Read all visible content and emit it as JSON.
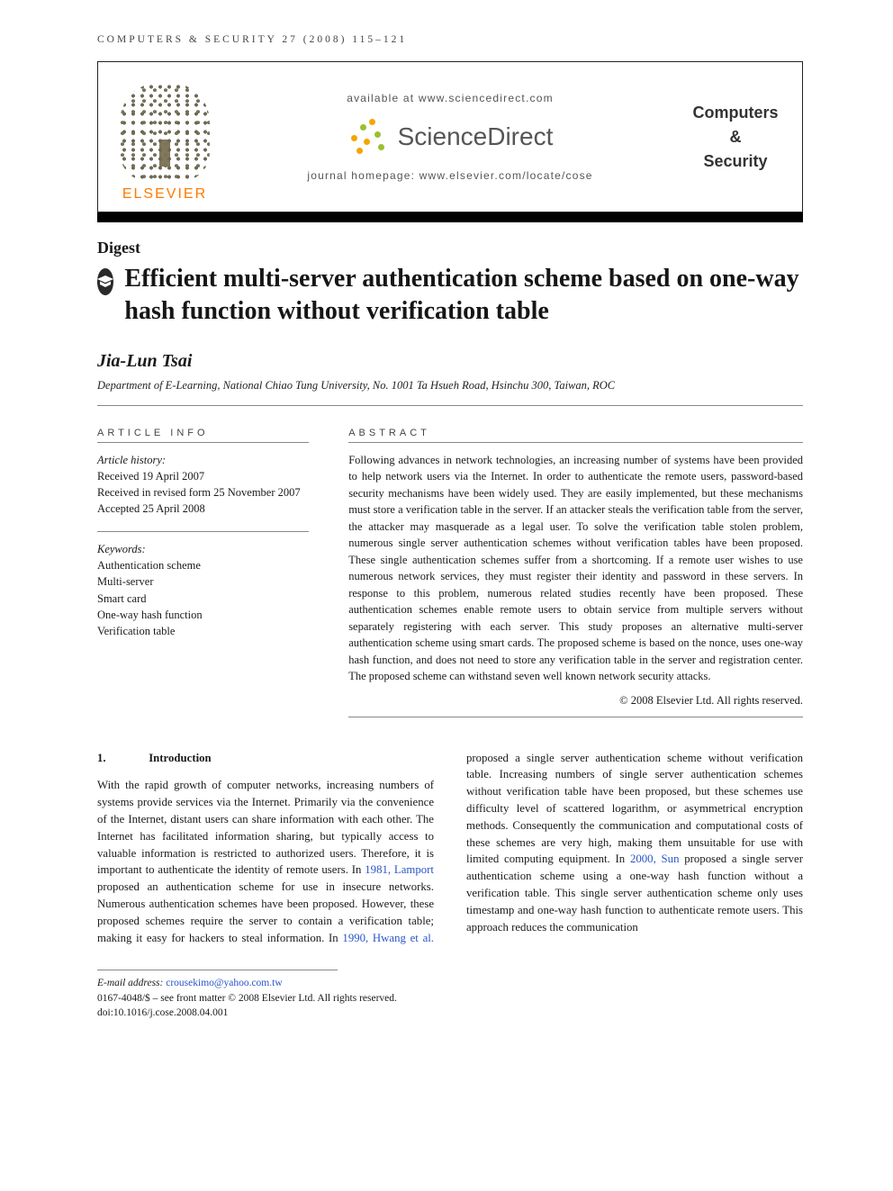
{
  "running_head": "COMPUTERS & SECURITY 27 (2008) 115–121",
  "banner": {
    "available_at": "available at www.sciencedirect.com",
    "sd_brand": "ScienceDirect",
    "homepage": "journal homepage: www.elsevier.com/locate/cose",
    "elsevier": "ELSEVIER",
    "journal_lines": [
      "Computers",
      "&",
      "Security"
    ]
  },
  "section_label": "Digest",
  "title": "Efficient multi-server authentication scheme based on one-way hash function without verification table",
  "author": "Jia-Lun Tsai",
  "affiliation": "Department of E-Learning, National Chiao Tung University, No. 1001 Ta Hsueh Road, Hsinchu 300, Taiwan, ROC",
  "article_info": {
    "heading": "ARTICLE INFO",
    "history_label": "Article history:",
    "received": "Received 19 April 2007",
    "revised": "Received in revised form 25 November 2007",
    "accepted": "Accepted 25 April 2008",
    "keywords_label": "Keywords:",
    "keywords": [
      "Authentication scheme",
      "Multi-server",
      "Smart card",
      "One-way hash function",
      "Verification table"
    ]
  },
  "abstract": {
    "heading": "ABSTRACT",
    "text": "Following advances in network technologies, an increasing number of systems have been provided to help network users via the Internet. In order to authenticate the remote users, password-based security mechanisms have been widely used. They are easily implemented, but these mechanisms must store a verification table in the server. If an attacker steals the verification table from the server, the attacker may masquerade as a legal user. To solve the verification table stolen problem, numerous single server authentication schemes without verification tables have been proposed. These single authentication schemes suffer from a shortcoming. If a remote user wishes to use numerous network services, they must register their identity and password in these servers. In response to this problem, numerous related studies recently have been proposed. These authentication schemes enable remote users to obtain service from multiple servers without separately registering with each server. This study proposes an alternative multi-server authentication scheme using smart cards. The proposed scheme is based on the nonce, uses one-way hash function, and does not need to store any verification table in the server and registration center. The proposed scheme can withstand seven well known network security attacks.",
    "copyright": "© 2008 Elsevier Ltd. All rights reserved."
  },
  "intro": {
    "num": "1.",
    "title": "Introduction",
    "col1": "With the rapid growth of computer networks, increasing numbers of systems provide services via the Internet. Primarily via the convenience of the Internet, distant users can share information with each other. The Internet has facilitated information sharing, but typically access to valuable information is restricted to authorized users. Therefore, it is important to authenticate the identity of remote users. In ",
    "cite1": "1981, Lamport",
    "col1b": " proposed an authentication scheme for use in insecure networks. Numerous authentication schemes have been proposed. However, these proposed schemes require the server to contain a verification table; making it easy for hackers to",
    "col2a": "steal information. In ",
    "cite2": "1990, Hwang et al.",
    "col2b": " proposed a single server authentication scheme without verification table. Increasing numbers of single server authentication schemes without verification table have been proposed, but these schemes use difficulty level of scattered logarithm, or asymmetrical encryption methods. Consequently the communication and computational costs of these schemes are very high, making them unsuitable for use with limited computing equipment. In ",
    "cite3": "2000, Sun",
    "col2c": " proposed a single server authentication scheme using a one-way hash function without a verification table. This single server authentication scheme only uses timestamp and one-way hash function to authenticate remote users. This approach reduces the communication"
  },
  "footer": {
    "email_label": "E-mail address: ",
    "email": "crousekimo@yahoo.com.tw",
    "front_matter": "0167-4048/$ – see front matter © 2008 Elsevier Ltd. All rights reserved.",
    "doi": "doi:10.1016/j.cose.2008.04.001"
  }
}
